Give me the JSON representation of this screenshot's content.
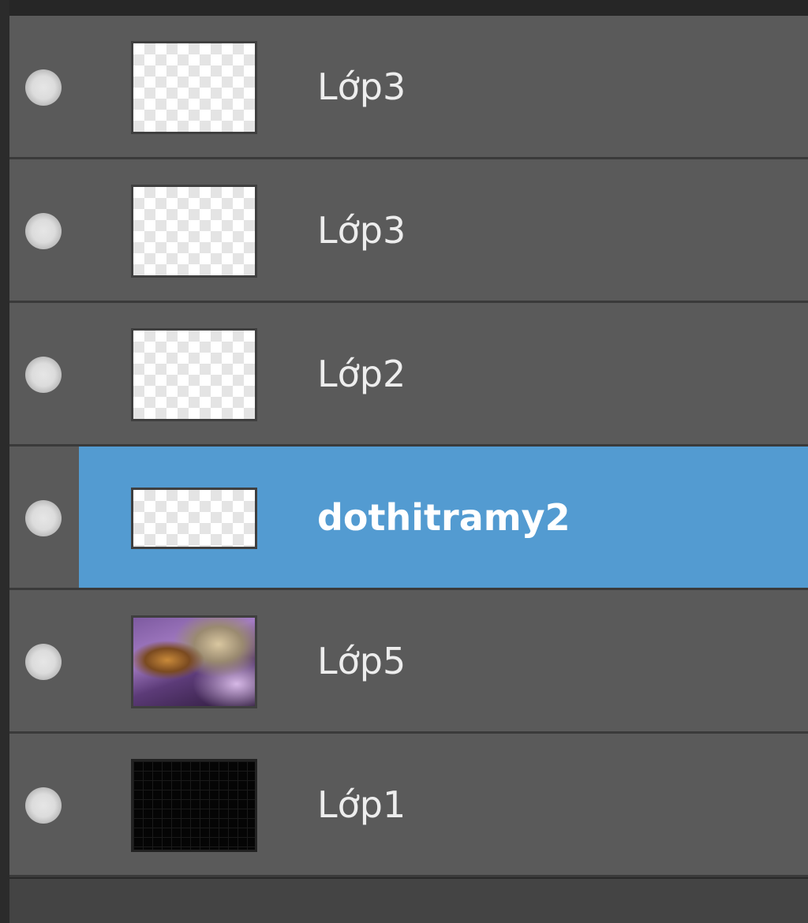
{
  "layers_panel": {
    "layers": [
      {
        "name": "Lớp3",
        "thumbnail": "transparent",
        "selected": false,
        "visible": true
      },
      {
        "name": "Lớp3",
        "thumbnail": "transparent",
        "selected": false,
        "visible": true
      },
      {
        "name": "Lớp2",
        "thumbnail": "transparent",
        "selected": false,
        "visible": true
      },
      {
        "name": "dothitramy2",
        "thumbnail": "transparent-wide",
        "selected": true,
        "visible": true
      },
      {
        "name": "Lớp5",
        "thumbnail": "photo",
        "selected": false,
        "visible": true
      },
      {
        "name": "Lớp1",
        "thumbnail": "black",
        "selected": false,
        "visible": true
      }
    ]
  },
  "colors": {
    "row_background": "#5a5a5a",
    "selected_highlight": "#539bd1",
    "separator": "#3a3a3a",
    "panel_background": "#2a2a2a",
    "text": "#ededed"
  },
  "icons": {
    "visibility": "visibility-dot-icon"
  }
}
